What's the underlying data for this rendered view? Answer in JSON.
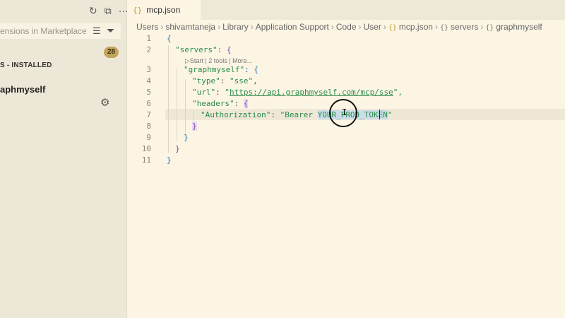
{
  "sidebar": {
    "actions": [
      "↻",
      "⧉",
      "···"
    ],
    "search": {
      "placeholder": "ensions in Marketplace"
    },
    "badge": "28",
    "section_title": "S - INSTALLED",
    "extension_name": "aphmyself"
  },
  "tab": {
    "icon": "{}",
    "label": "mcp.json"
  },
  "breadcrumb": {
    "items": [
      "Users",
      "shivamtaneja",
      "Library",
      "Application Support",
      "Code",
      "User"
    ],
    "file": "mcp.json",
    "obj1": "servers",
    "obj2": "graphmyself"
  },
  "codelens": "▷Start | 2 tools | More...",
  "editor": {
    "line_numbers": [
      "1",
      "2",
      "3",
      "4",
      "5",
      "6",
      "7",
      "8",
      "9",
      "10",
      "11"
    ],
    "lines": {
      "l1": "{",
      "l2_key": "\"servers\"",
      "l2_rest": ": {",
      "l3_key": "\"graphmyself\"",
      "l3_rest": ": {",
      "l4_key": "\"type\"",
      "l4_colon": ": ",
      "l4_val": "\"sse\"",
      "l4_comma": ",",
      "l5_key": "\"url\"",
      "l5_colon": ": ",
      "l5_q1": "\"",
      "l5_url": "https://api.graphmyself.com/mcp/sse",
      "l5_q2": "\",",
      "l6_key": "\"headers\"",
      "l6_colon": ": ",
      "l6_brace": "{",
      "l7_key": "\"Authorization\"",
      "l7_colon": ": ",
      "l7_val_a": "\"Bearer ",
      "l7_val_sel": "YOUR_PROD_TOKEN",
      "l7_val_b": "\"",
      "l8": "}",
      "l9": "}",
      "l10": "}",
      "l11": "}"
    }
  },
  "colors": {
    "sidebar_bg": "#ede7d7",
    "editor_bg": "#fcf5e4",
    "string": "#2a8c4a",
    "bracket": "#2a6fb8",
    "selection": "#cbdde8"
  }
}
